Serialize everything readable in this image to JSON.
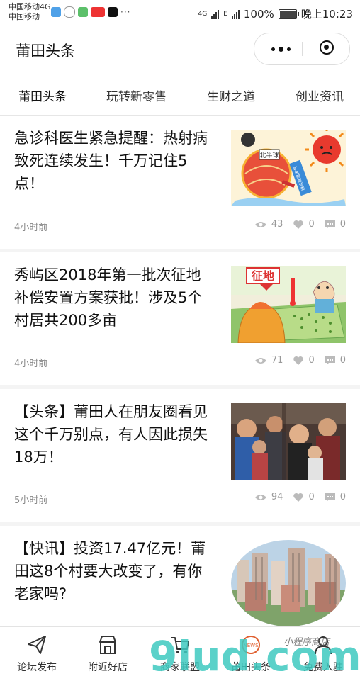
{
  "status_bar": {
    "carrier_1": "中国移动4G",
    "carrier_2": "中国移动",
    "network_1": "4G",
    "network_2": "E",
    "battery": "100%",
    "time": "晚上10:23",
    "app_icons": [
      "message-icon",
      "wechat-icon",
      "app-icon",
      "toutiao-icon",
      "tiktok-icon"
    ]
  },
  "header": {
    "title": "莆田头条"
  },
  "tabs": [
    {
      "label": "莆田头条",
      "active": true
    },
    {
      "label": "玩转新零售",
      "active": false
    },
    {
      "label": "生财之道",
      "active": false
    },
    {
      "label": "创业资讯",
      "active": false
    }
  ],
  "articles": [
    {
      "title": "急诊科医生紧急提醒：热射病致死连续发生！千万记住5点！",
      "time": "4小时前",
      "views": "43",
      "likes": "0",
      "comments": "0",
      "image_text_1": "北半球",
      "image_text_2": "继续高温天气"
    },
    {
      "title": "秀屿区2018年第一批次征地补偿安置方案获批！涉及5个村居共200多亩",
      "time": "4小时前",
      "views": "71",
      "likes": "0",
      "comments": "0",
      "image_text_1": "征地"
    },
    {
      "title": "【头条】莆田人在朋友圈看见这个千万别点，有人因此损失18万！",
      "time": "5小时前",
      "views": "94",
      "likes": "0",
      "comments": "0"
    },
    {
      "title": "【快讯】投资17.47亿元！莆田这8个村要大改变了，有你老家吗?"
    }
  ],
  "bottom_nav": [
    {
      "label": "论坛发布",
      "icon": "paper-plane-icon"
    },
    {
      "label": "附近好店",
      "icon": "store-icon"
    },
    {
      "label": "商家联盟",
      "icon": "cart-icon"
    },
    {
      "label": "莆田头条",
      "icon": "news-icon"
    },
    {
      "label": "免费入驻",
      "icon": "user-icon"
    }
  ],
  "watermark": {
    "text_main": "9lud.com",
    "text_sub": "小程序商店"
  },
  "colors": {
    "background": "#f4f4f4",
    "watermark_teal": "#3ec9c0"
  }
}
